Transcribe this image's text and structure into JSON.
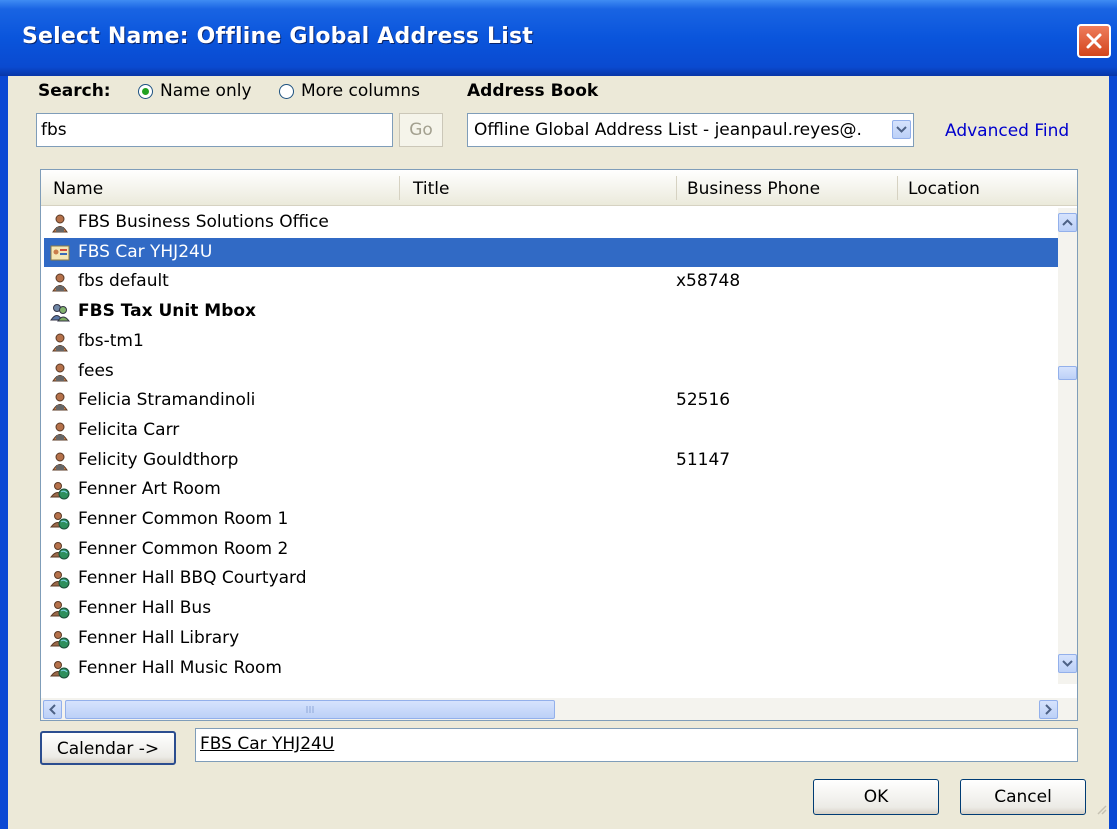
{
  "window": {
    "title": "Select Name: Offline Global Address List"
  },
  "search": {
    "label": "Search:",
    "radio_name_only": "Name only",
    "radio_more_columns": "More columns",
    "selected": "Name only",
    "query": "fbs",
    "go_label": "Go"
  },
  "address_book": {
    "label": "Address Book",
    "selected": "Offline Global Address List - jeanpaul.reyes@.",
    "advanced_find": "Advanced Find"
  },
  "columns": [
    "Name",
    "Title",
    "Business Phone",
    "Location"
  ],
  "rows": [
    {
      "name": "FBS Business Solutions Office",
      "phone": "",
      "icon": "user-icon"
    },
    {
      "name": "FBS Car YHJ24U",
      "phone": "",
      "icon": "resource-card-icon",
      "selected": true
    },
    {
      "name": "fbs default",
      "phone": "x58748",
      "icon": "user-icon"
    },
    {
      "name": "FBS Tax Unit Mbox",
      "phone": "",
      "icon": "distribution-list-icon",
      "bold": true
    },
    {
      "name": "fbs-tm1",
      "phone": "",
      "icon": "user-icon"
    },
    {
      "name": "fees",
      "phone": "",
      "icon": "user-icon"
    },
    {
      "name": "Felicia Stramandinoli",
      "phone": "52516",
      "icon": "user-icon"
    },
    {
      "name": "Felicita Carr",
      "phone": "",
      "icon": "user-icon"
    },
    {
      "name": "Felicity Gouldthorp",
      "phone": "51147",
      "icon": "user-icon"
    },
    {
      "name": "Fenner Art Room",
      "phone": "",
      "icon": "room-icon"
    },
    {
      "name": "Fenner Common Room 1",
      "phone": "",
      "icon": "room-icon"
    },
    {
      "name": "Fenner Common Room 2",
      "phone": "",
      "icon": "room-icon"
    },
    {
      "name": "Fenner Hall BBQ Courtyard",
      "phone": "",
      "icon": "room-icon"
    },
    {
      "name": "Fenner Hall Bus",
      "phone": "",
      "icon": "room-icon"
    },
    {
      "name": "Fenner Hall Library",
      "phone": "",
      "icon": "room-icon"
    },
    {
      "name": "Fenner Hall Music Room",
      "phone": "",
      "icon": "room-icon"
    }
  ],
  "calendar": {
    "button_label": "Calendar ->",
    "value": "FBS Car YHJ24U"
  },
  "footer": {
    "ok_label": "OK",
    "cancel_label": "Cancel"
  },
  "colors": {
    "selection": "#316ac5",
    "titlebar": "#0a55dc",
    "dialog": "#ece9d8",
    "link": "#0000cc"
  }
}
